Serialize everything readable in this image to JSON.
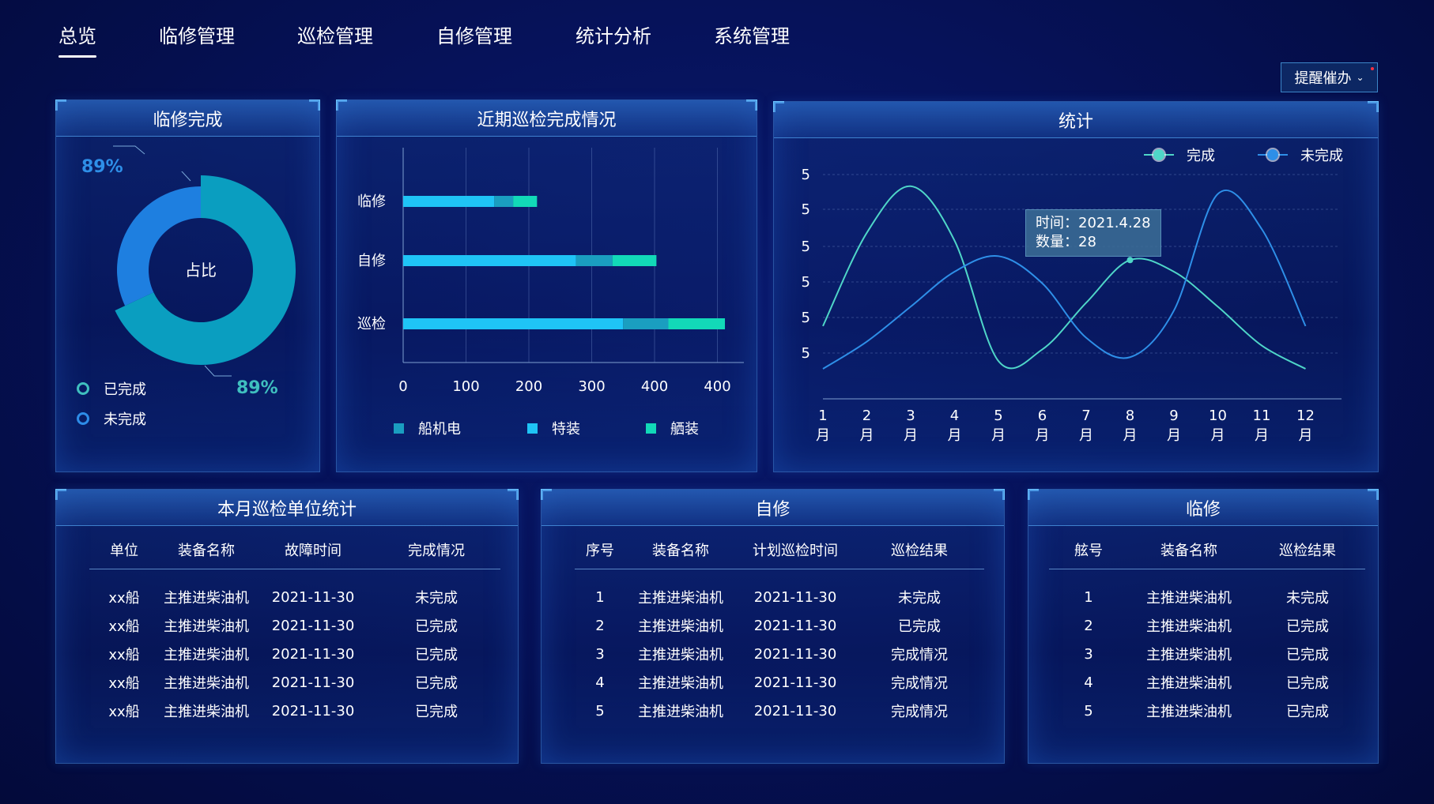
{
  "nav": {
    "tabs": [
      {
        "label": "总览",
        "active": true
      },
      {
        "label": "临修管理"
      },
      {
        "label": "巡检管理"
      },
      {
        "label": "自修管理"
      },
      {
        "label": "统计分析"
      },
      {
        "label": "系统管理"
      }
    ],
    "remind_label": "提醒催办"
  },
  "repair_done": {
    "title": "临修完成",
    "center_label": "占比",
    "pct_top": "89%",
    "pct_bottom": "89%",
    "done_fraction": 0.68,
    "legend": [
      {
        "label": "已完成",
        "color": "#3fbfbf"
      },
      {
        "label": "未完成",
        "color": "#2d8ce8"
      }
    ],
    "colors": {
      "done": "#0a9ec0",
      "undone": "#1e7fe0"
    }
  },
  "inspection": {
    "title": "近期巡检完成情况",
    "chart_data": {
      "type": "bar",
      "orientation": "horizontal",
      "stacked": true,
      "categories": [
        "临修",
        "自修",
        "巡检"
      ],
      "x_tick_labels": [
        "0",
        "100",
        "200",
        "300",
        "400",
        "400"
      ],
      "series": [
        {
          "name": "船机电",
          "color": "#1a9ec0",
          "values": [
            0,
            0,
            0
          ]
        },
        {
          "name": "特装",
          "color": "#1fc4f6",
          "values": [
            145,
            275,
            350
          ]
        },
        {
          "name": "舾装",
          "color": "#12d9b8",
          "values": [
            40,
            70,
            90
          ]
        }
      ],
      "segments": [
        {
          "category": "临修",
          "parts": [
            145,
            30,
            38
          ]
        },
        {
          "category": "自修",
          "parts": [
            275,
            58,
            70
          ]
        },
        {
          "category": "巡检",
          "parts": [
            350,
            72,
            90
          ]
        }
      ],
      "legend_placement": "bottom",
      "grid": true
    }
  },
  "stats": {
    "title": "统计",
    "tooltip": {
      "line1": "时间：2021.4.28",
      "line2": "数量：28"
    },
    "chart_data": {
      "type": "line",
      "smooth": true,
      "x": [
        "1月",
        "2月",
        "3月",
        "4月",
        "5月",
        "6月",
        "7月",
        "8月",
        "9月",
        "10月",
        "11月",
        "12月"
      ],
      "x_num": [
        "1",
        "2",
        "3",
        "4",
        "5",
        "6",
        "7",
        "8",
        "9",
        "10",
        "11",
        "12"
      ],
      "x_unit": "月",
      "y_tick_labels": [
        "5",
        "5",
        "5",
        "5",
        "5",
        "5"
      ],
      "series": [
        {
          "name": "完成",
          "color": "#4fd6c8",
          "values": [
            1.1,
            3.5,
            4.7,
            3.3,
            0.2,
            0.5,
            1.7,
            2.8,
            2.5,
            1.6,
            0.6,
            0.0
          ]
        },
        {
          "name": "未完成",
          "color": "#2e8fe8",
          "values": [
            0.0,
            0.7,
            1.6,
            2.5,
            2.9,
            2.2,
            0.8,
            0.3,
            1.5,
            4.5,
            3.6,
            1.1
          ]
        }
      ],
      "legend_placement": "top-right",
      "grid": true
    }
  },
  "monthly": {
    "title": "本月巡检单位统计",
    "headers": [
      "单位",
      "装备名称",
      "故障时间",
      "完成情况"
    ],
    "rows": [
      [
        "xx船",
        "主推进柴油机",
        "2021-11-30",
        "未完成"
      ],
      [
        "xx船",
        "主推进柴油机",
        "2021-11-30",
        "已完成"
      ],
      [
        "xx船",
        "主推进柴油机",
        "2021-11-30",
        "已完成"
      ],
      [
        "xx船",
        "主推进柴油机",
        "2021-11-30",
        "已完成"
      ],
      [
        "xx船",
        "主推进柴油机",
        "2021-11-30",
        "已完成"
      ]
    ]
  },
  "self_repair": {
    "title": "自修",
    "headers": [
      "序号",
      "装备名称",
      "计划巡检时间",
      "巡检结果"
    ],
    "rows": [
      [
        "1",
        "主推进柴油机",
        "2021-11-30",
        "未完成"
      ],
      [
        "2",
        "主推进柴油机",
        "2021-11-30",
        "已完成"
      ],
      [
        "3",
        "主推进柴油机",
        "2021-11-30",
        "完成情况"
      ],
      [
        "4",
        "主推进柴油机",
        "2021-11-30",
        "完成情况"
      ],
      [
        "5",
        "主推进柴油机",
        "2021-11-30",
        "完成情况"
      ]
    ]
  },
  "temp_repair": {
    "title": "临修",
    "headers": [
      "舷号",
      "装备名称",
      "巡检结果"
    ],
    "rows": [
      [
        "1",
        "主推进柴油机",
        "未完成"
      ],
      [
        "2",
        "主推进柴油机",
        "已完成"
      ],
      [
        "3",
        "主推进柴油机",
        "已完成"
      ],
      [
        "4",
        "主推进柴油机",
        "已完成"
      ],
      [
        "5",
        "主推进柴油机",
        "已完成"
      ]
    ]
  }
}
